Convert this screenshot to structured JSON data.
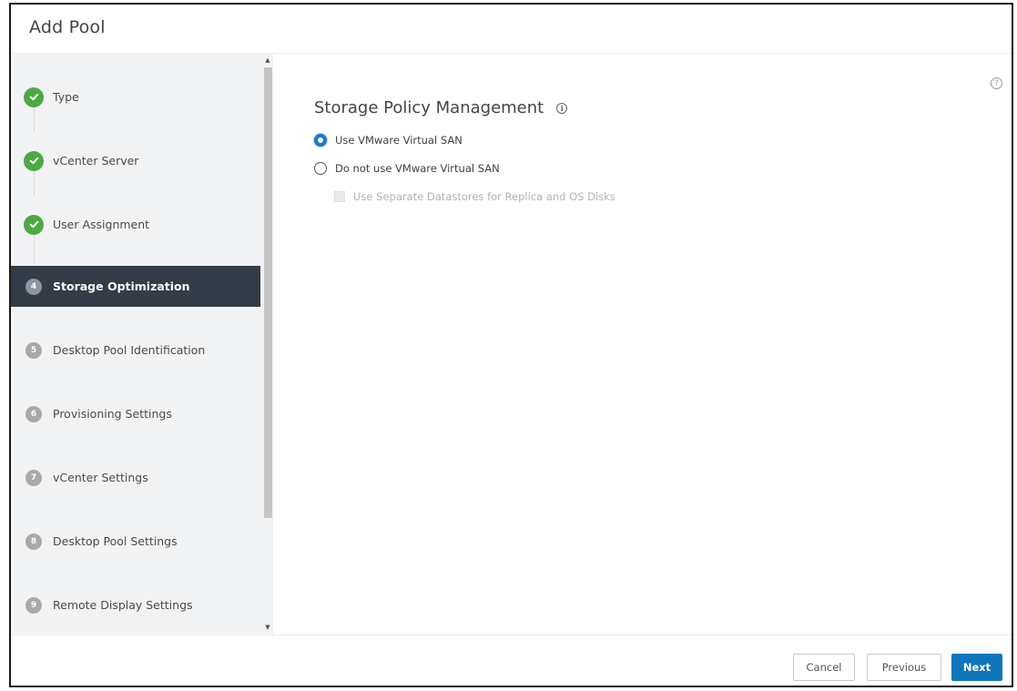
{
  "dialog": {
    "title": "Add Pool"
  },
  "sidebar": {
    "steps": [
      {
        "label": "Type",
        "status": "done",
        "icon": "check-icon"
      },
      {
        "label": "vCenter Server",
        "status": "done",
        "icon": "check-icon"
      },
      {
        "label": "User Assignment",
        "status": "done",
        "icon": "check-icon"
      },
      {
        "label": "Storage Optimization",
        "status": "active",
        "number": "4"
      },
      {
        "label": "Desktop Pool Identification",
        "status": "pending",
        "number": "5"
      },
      {
        "label": "Provisioning Settings",
        "status": "pending",
        "number": "6"
      },
      {
        "label": "vCenter Settings",
        "status": "pending",
        "number": "7"
      },
      {
        "label": "Desktop Pool Settings",
        "status": "pending",
        "number": "8"
      },
      {
        "label": "Remote Display Settings",
        "status": "pending",
        "number": "9"
      }
    ]
  },
  "main": {
    "heading": "Storage Policy Management",
    "help_icon": "?",
    "info_icon": "i",
    "options": [
      {
        "label": "Use VMware Virtual SAN",
        "selected": true
      },
      {
        "label": "Do not use VMware Virtual SAN",
        "selected": false
      }
    ],
    "checkbox": {
      "label": "Use Separate Datastores for Replica and OS Disks",
      "checked": false,
      "disabled": true
    }
  },
  "footer": {
    "cancel_label": "Cancel",
    "previous_label": "Previous",
    "next_label": "Next"
  },
  "colors": {
    "active_step_bg": "#333c47",
    "done_badge": "#4da944",
    "primary_button": "#0f75bc",
    "radio_selected": "#1b7ac8"
  }
}
